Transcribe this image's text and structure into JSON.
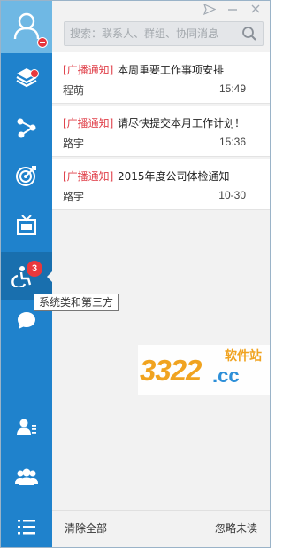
{
  "window": {
    "title_buttons": [
      "send-icon",
      "minimize-icon",
      "close-icon"
    ]
  },
  "sidebar": {
    "items": [
      {
        "id": "messages",
        "icon": "stack-icon",
        "has_dot": true
      },
      {
        "id": "share",
        "icon": "share-icon",
        "has_dot": false
      },
      {
        "id": "target",
        "icon": "target-icon",
        "has_dot": false
      },
      {
        "id": "news",
        "icon": "news-icon",
        "has_dot": false
      },
      {
        "id": "system",
        "icon": "accessibility-icon",
        "badge": "3",
        "active": true
      },
      {
        "id": "chat",
        "icon": "chat-bubble-icon",
        "has_dot": false
      },
      {
        "id": "contacts",
        "icon": "contact-list-icon"
      },
      {
        "id": "groups",
        "icon": "group-icon"
      },
      {
        "id": "menu",
        "icon": "menu-icon"
      }
    ],
    "tooltip": "系统类和第三方"
  },
  "search": {
    "placeholder": "搜索：联系人、群组、协同消息"
  },
  "notifications": [
    {
      "tag": "[广播通知]",
      "title": "本周重要工作事项安排",
      "sender": "程萌",
      "time": "15:49"
    },
    {
      "tag": "[广播通知]",
      "title": "请尽快提交本月工作计划！",
      "sender": "路宇",
      "time": "15:36"
    },
    {
      "tag": "[广播通知]",
      "title": "2015年度公司体检通知",
      "sender": "路宇",
      "time": "10-30"
    }
  ],
  "footer": {
    "clear_all": "清除全部",
    "ignore_unread": "忽略未读"
  },
  "watermark": {
    "number": "3322",
    "domain": ".cc",
    "label": "软件站"
  },
  "colors": {
    "sidebar": "#1f82cc",
    "sidebar_active": "#196fae",
    "avatar_bg": "#6fb8e4",
    "tag_red": "#e0404a",
    "badge_red": "#e8383d"
  }
}
